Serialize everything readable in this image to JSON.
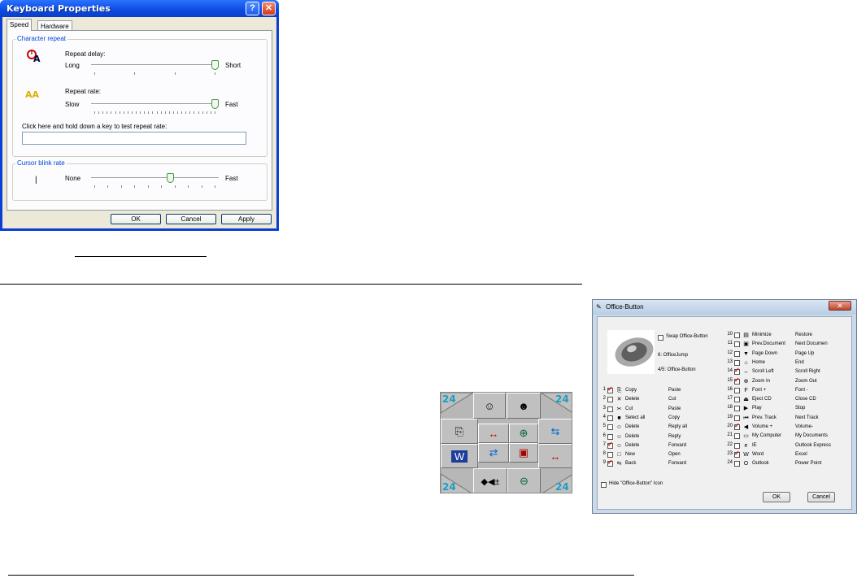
{
  "keyboard_properties": {
    "title": "Keyboard Properties",
    "help_glyph": "?",
    "close_glyph": "✕",
    "tabs": [
      "Speed",
      "Hardware"
    ],
    "active_tab": "Speed",
    "character_repeat": {
      "group_label": "Character repeat",
      "repeat_delay": {
        "label": "Repeat delay:",
        "min_label": "Long",
        "max_label": "Short",
        "value_fraction": 1.0
      },
      "repeat_rate": {
        "label": "Repeat rate:",
        "min_label": "Slow",
        "max_label": "Fast",
        "value_fraction": 1.0
      },
      "test_label": "Click here and hold down a key to test repeat rate:",
      "test_value": ""
    },
    "cursor_blink": {
      "group_label": "Cursor blink rate",
      "cursor_glyph": "|",
      "min_label": "None",
      "max_label": "Fast",
      "value_fraction": 0.63
    },
    "buttons": {
      "ok": "OK",
      "cancel": "Cancel",
      "apply": "Apply"
    }
  },
  "icon_grid": {
    "corner_number": "24",
    "icons": [
      "paste-icon",
      "reply-icon",
      "reply-all-icon",
      "scroll-left-icon",
      "zoom-in-icon",
      "next-doc-icon",
      "word-icon",
      "swap-icon",
      "copy-icon",
      "scroll-right-icon",
      "volume-icon",
      "zoom-out-icon"
    ],
    "volume_label": "◆◀±"
  },
  "office_button": {
    "title": "Office-Button",
    "close_glyph": "✕",
    "swap_label": "Swap Office-Button",
    "label_6": "6: OfficeJump",
    "label_45": "4/5: Office-Button",
    "left_rows": [
      {
        "n": "1",
        "checked": true,
        "a1": "Copy",
        "a2": "Paste",
        "icon": "copy-icon",
        "glyph": "⎘"
      },
      {
        "n": "2",
        "checked": false,
        "a1": "Delete",
        "a2": "Cut",
        "icon": "delete-icon",
        "glyph": "✕"
      },
      {
        "n": "3",
        "checked": false,
        "a1": "Cut",
        "a2": "Paste",
        "icon": "scissors-icon",
        "glyph": "✂"
      },
      {
        "n": "4",
        "checked": false,
        "a1": "Select all",
        "a2": "Copy",
        "icon": "select-all-icon",
        "glyph": "■"
      },
      {
        "n": "5",
        "checked": false,
        "a1": "Delete",
        "a2": "Reply all",
        "icon": "mail-icon",
        "glyph": "☺"
      },
      {
        "n": "6",
        "checked": false,
        "a1": "Delete",
        "a2": "Reply",
        "icon": "reply-icon",
        "glyph": "☺"
      },
      {
        "n": "7",
        "checked": true,
        "a1": "Delete",
        "a2": "Forward",
        "icon": "forward-icon",
        "glyph": "☺"
      },
      {
        "n": "8",
        "checked": false,
        "a1": "New",
        "a2": "Open",
        "icon": "new-icon",
        "glyph": "□"
      },
      {
        "n": "9",
        "checked": true,
        "a1": "Back",
        "a2": "Forward",
        "icon": "back-icon",
        "glyph": "⇆"
      }
    ],
    "right_rows": [
      {
        "n": "10",
        "checked": false,
        "a1": "Minimize",
        "a2": "Restore",
        "icon": "minimize-icon",
        "glyph": "▤"
      },
      {
        "n": "11",
        "checked": false,
        "a1": "Prev.Document",
        "a2": "Next Documen",
        "icon": "prev-doc-icon",
        "glyph": "▣"
      },
      {
        "n": "12",
        "checked": false,
        "a1": "Page Down",
        "a2": "Page Up",
        "icon": "page-down-icon",
        "glyph": "▼"
      },
      {
        "n": "13",
        "checked": false,
        "a1": "Home",
        "a2": "End",
        "icon": "home-icon",
        "glyph": "⌂"
      },
      {
        "n": "14",
        "checked": true,
        "a1": "Scroll Left",
        "a2": "Scroll Right",
        "icon": "scroll-icon",
        "glyph": "↔"
      },
      {
        "n": "15",
        "checked": true,
        "a1": "Zoom In",
        "a2": "Zoom Out",
        "icon": "zoom-icon",
        "glyph": "⊕"
      },
      {
        "n": "16",
        "checked": false,
        "a1": "Font +",
        "a2": "Font -",
        "icon": "font-icon",
        "glyph": "F"
      },
      {
        "n": "17",
        "checked": false,
        "a1": "Eject CD",
        "a2": "Close CD",
        "icon": "eject-icon",
        "glyph": "⏏"
      },
      {
        "n": "18",
        "checked": false,
        "a1": "Play",
        "a2": "Stop",
        "icon": "play-icon",
        "glyph": "▶"
      },
      {
        "n": "19",
        "checked": false,
        "a1": "Prev. Track",
        "a2": "Next Track",
        "icon": "prev-track-icon",
        "glyph": "⏮"
      },
      {
        "n": "20",
        "checked": true,
        "a1": "Volume +",
        "a2": "Volume-",
        "icon": "volume-icon",
        "glyph": "◀"
      },
      {
        "n": "21",
        "checked": false,
        "a1": "My Computer",
        "a2": "My Documents",
        "icon": "computer-icon",
        "glyph": "▭"
      },
      {
        "n": "22",
        "checked": false,
        "a1": "IE",
        "a2": "Outlook Express",
        "icon": "ie-icon",
        "glyph": "e"
      },
      {
        "n": "23",
        "checked": true,
        "a1": "Word",
        "a2": "Excel",
        "icon": "word-icon",
        "glyph": "W"
      },
      {
        "n": "24",
        "checked": false,
        "a1": "Outlook",
        "a2": "Power Point",
        "icon": "outlook-icon",
        "glyph": "O"
      }
    ],
    "hide_label": "Hide \"Office-Button\" Icon",
    "ok": "OK",
    "cancel": "Cancel"
  }
}
